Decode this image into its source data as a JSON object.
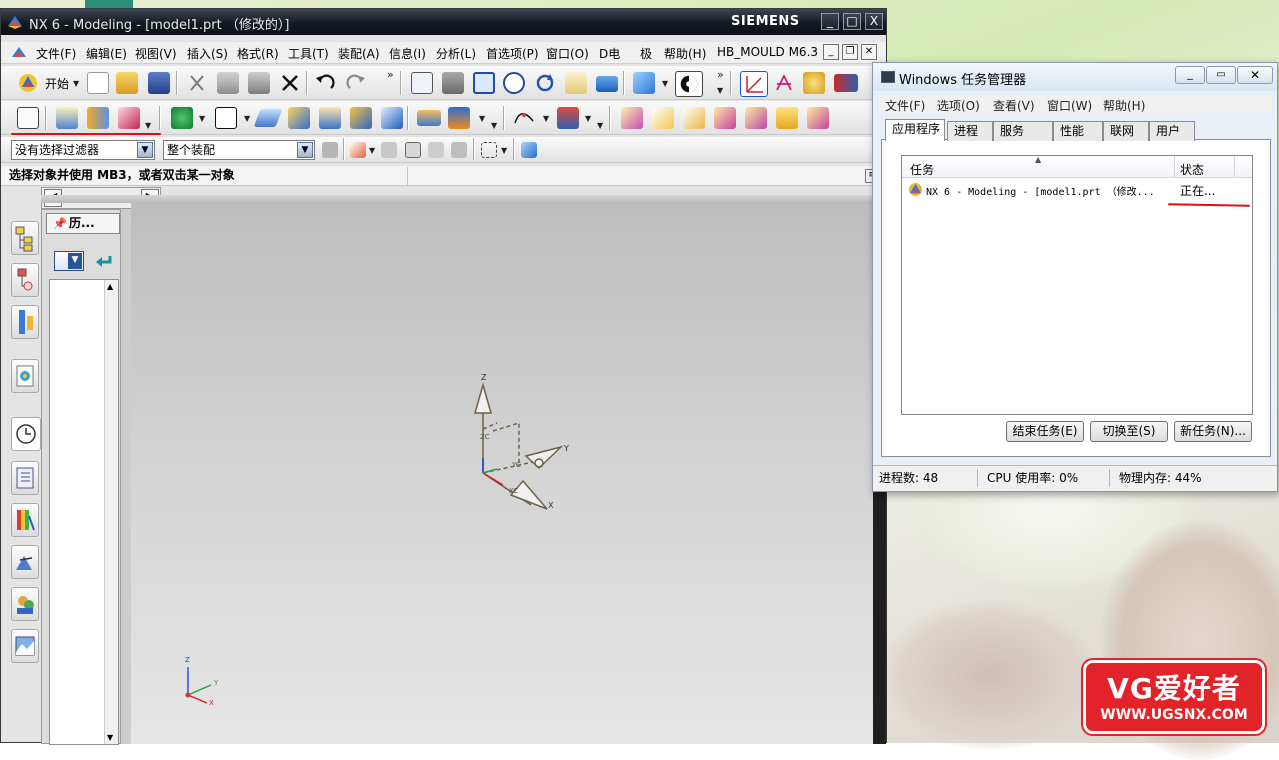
{
  "desktop": {
    "taskbar_fragment_color": "#2a8f74"
  },
  "nx": {
    "title": "NX 6 - Modeling - [model1.prt （修改的）]",
    "brand": "SIEMENS",
    "window_buttons": [
      "_",
      "□",
      "X"
    ],
    "menu": [
      "文件(F)",
      "编辑(E)",
      "视图(V)",
      "插入(S)",
      "格式(R)",
      "工具(T)",
      "装配(A)",
      "信息(I)",
      "分析(L)",
      "首选项(P)",
      "窗口(O)",
      "D电",
      "极",
      "帮助(H)",
      "HB_MOULD M6.3"
    ],
    "toolbar1": {
      "start_label": "开始",
      "icons": [
        "new-icon",
        "open-icon",
        "save-icon",
        "cut-icon",
        "copy-icon",
        "paste-icon",
        "delete-icon",
        "undo-icon",
        "redo-icon",
        "fit-icon",
        "zoom-window-icon",
        "zoom-icon",
        "zoom-in-icon",
        "rotate-icon",
        "pan-icon",
        "shaded-icon",
        "render-style-icon",
        "wcs-icon",
        "datum-csys-icon",
        "navigator-icon"
      ]
    },
    "toolbar2": {
      "icons": [
        "sketch-icon",
        "extrude-icon",
        "revolve-icon",
        "hole-icon",
        "datum-plane-icon",
        "block-icon",
        "sweep-icon",
        "boolean-icon",
        "blend-icon",
        "chamfer-icon",
        "shell-icon",
        "trim-body-icon",
        "curve-icon",
        "face-icon",
        "assembly-1-icon",
        "assembly-2-icon",
        "assembly-3-icon",
        "assembly-4-icon",
        "assembly-5-icon",
        "assembly-6-icon",
        "assembly-7-icon"
      ]
    },
    "selection_bar": {
      "filter_value": "没有选择过滤器",
      "scope_value": "整个装配"
    },
    "status_text": "选择对象并使用 MB3，或者双击某一对象",
    "navigator": {
      "tab_label": "历..."
    },
    "csys_labels": {
      "z": "Z",
      "y": "Y",
      "x": "X",
      "zc": "ZC",
      "xc": "XC",
      "yc": "YC"
    },
    "triad_labels": {
      "z": "Z",
      "y": "Y",
      "x": "X"
    },
    "accent_red": "#e01010"
  },
  "taskmanager": {
    "title": "Windows 任务管理器",
    "menu": [
      "文件(F)",
      "选项(O)",
      "查看(V)",
      "窗口(W)",
      "帮助(H)"
    ],
    "tabs": [
      "应用程序",
      "进程",
      "服务",
      "性能",
      "联网",
      "用户"
    ],
    "active_tab": "应用程序",
    "columns": [
      "任务",
      "状态"
    ],
    "rows": [
      {
        "task": "NX 6 - Modeling - [model1.prt （修改...",
        "status": "正在..."
      }
    ],
    "buttons": {
      "end_task": "结束任务(E)",
      "switch_to": "切换至(S)",
      "new_task": "新任务(N)..."
    },
    "status": {
      "processes": "进程数: 48",
      "cpu": "CPU 使用率: 0%",
      "memory": "物理内存: 44%"
    }
  },
  "watermark": {
    "title": "VG爱好者",
    "url": "WWW.UGSNX.COM"
  }
}
